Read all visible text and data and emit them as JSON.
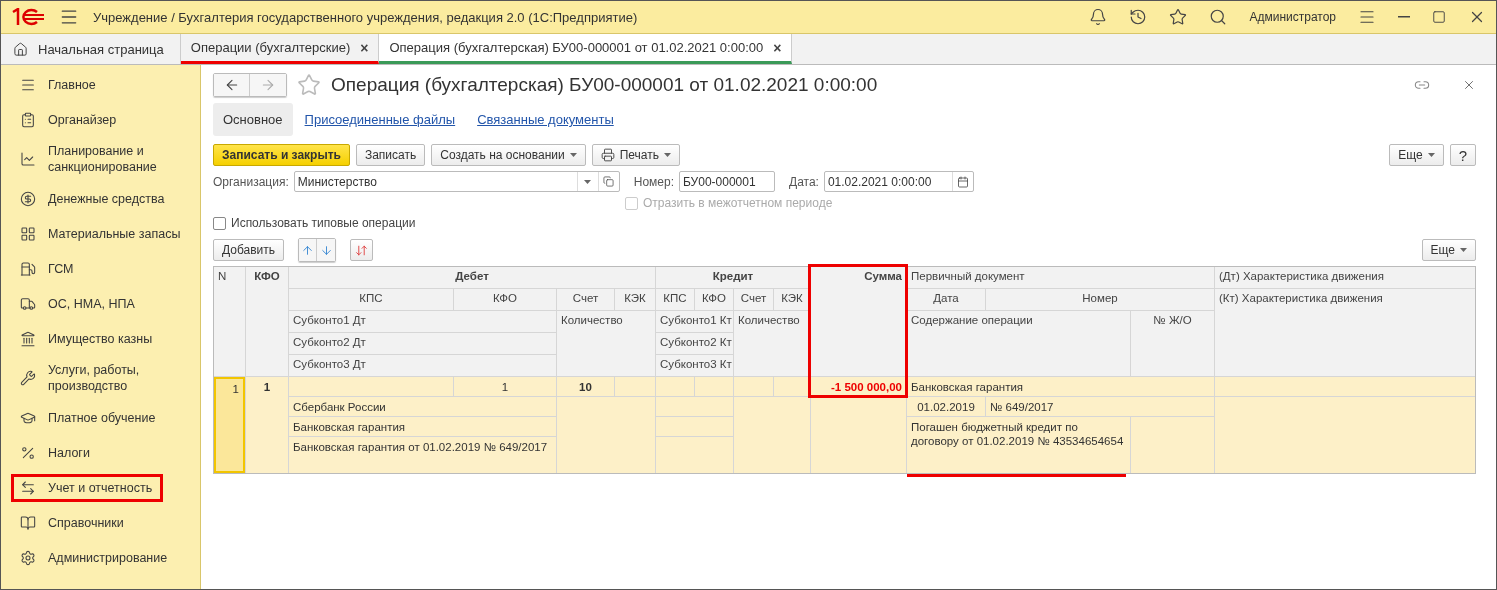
{
  "window": {
    "title": "Учреждение / Бухгалтерия государственного учреждения, редакция 2.0  (1С:Предприятие)",
    "user": "Администратор"
  },
  "home_tab": {
    "label": "Начальная страница"
  },
  "tabs": [
    {
      "label": "Операции (бухгалтерские)",
      "selected": false,
      "highlighted": true,
      "close": "×"
    },
    {
      "label": "Операция (бухгалтерская) БУ00-000001 от 01.02.2021 0:00:00",
      "selected": true,
      "highlighted": false,
      "close": "×"
    }
  ],
  "sidebar": {
    "items": [
      {
        "label": "Главное",
        "highlighted": false
      },
      {
        "label": "Органайзер",
        "highlighted": false
      },
      {
        "label": "Планирование и санкционирование",
        "highlighted": false
      },
      {
        "label": "Денежные средства",
        "highlighted": false
      },
      {
        "label": "Материальные запасы",
        "highlighted": false
      },
      {
        "label": "ГСМ",
        "highlighted": false
      },
      {
        "label": "ОС, НМА, НПА",
        "highlighted": false
      },
      {
        "label": "Имущество казны",
        "highlighted": false
      },
      {
        "label": "Услуги, работы, производство",
        "highlighted": false
      },
      {
        "label": "Платное обучение",
        "highlighted": false
      },
      {
        "label": "Налоги",
        "highlighted": false
      },
      {
        "label": "Учет и отчетность",
        "highlighted": true
      },
      {
        "label": "Справочники",
        "highlighted": false
      },
      {
        "label": "Администрирование",
        "highlighted": false
      }
    ]
  },
  "form": {
    "title": "Операция (бухгалтерская) БУ00-000001 от 01.02.2021 0:00:00",
    "sections": [
      {
        "label": "Основное",
        "selected": true
      },
      {
        "label": "Присоединенные файлы",
        "selected": false
      },
      {
        "label": "Связанные документы",
        "selected": false
      }
    ],
    "commands": [
      {
        "label": "Записать и закрыть",
        "kind": "primary"
      },
      {
        "label": "Записать",
        "kind": "plain"
      },
      {
        "label": "Создать на основании",
        "kind": "menu"
      },
      {
        "label": "Печать",
        "kind": "print"
      }
    ],
    "more": "Еще",
    "help": "?",
    "organization": {
      "label": "Организация:",
      "value": "Министерство"
    },
    "number": {
      "label": "Номер:",
      "value": "БУ00-000001"
    },
    "date": {
      "label": "Дата:",
      "value": "01.02.2021  0:00:00"
    },
    "interperiod": {
      "label": "Отразить в межотчетном периоде",
      "checked": false,
      "disabled": true
    },
    "typical": {
      "label": "Использовать типовые операции",
      "checked": false,
      "disabled": false
    },
    "add": "Добавить",
    "table_more": "Еще"
  },
  "table": {
    "header": {
      "n": "N",
      "kfo": "КФО",
      "debit": {
        "title": "Дебет",
        "kps": "КПС",
        "kfo": "КФО",
        "account": "Счет",
        "kek": "КЭК",
        "subconto": [
          "Субконто1 Дт",
          "Субконто2 Дт",
          "Субконто3 Дт"
        ],
        "quantity": "Количество"
      },
      "credit": {
        "title": "Кредит",
        "kps": "КПС",
        "kfo": "КФО",
        "account": "Счет",
        "kek": "КЭК",
        "subconto": [
          "Субконто1 Кт",
          "Субконто2 Кт",
          "Субконто3 Кт"
        ],
        "quantity": "Количество"
      },
      "sum": "Сумма",
      "sum_highlighted": true,
      "doc": {
        "title": "Первичный документ",
        "date": "Дата",
        "number": "Номер",
        "content": "Содержание операции",
        "journal": "№ Ж/О"
      },
      "dt_char": "(Дт) Характеристика движения",
      "kt_char": "(Кт) Характеристика движения"
    },
    "rows": [
      {
        "n": "1",
        "kfo": "1",
        "selected": true,
        "debit": {
          "kfo": "1",
          "account": "10",
          "subconto": [
            "Сбербанк России",
            "Банковская гарантия",
            "Банковская гарантия от 01.02.2019 № 649/2017"
          ]
        },
        "sum": "-1 500 000,00",
        "doc": {
          "title": "Банковская гарантия",
          "date": "01.02.2019",
          "number": "№ 649/2017",
          "content": "Погашен бюджетный кредит по договору от 01.02.2019 № 43534654654",
          "content_underlined": true
        }
      }
    ]
  }
}
